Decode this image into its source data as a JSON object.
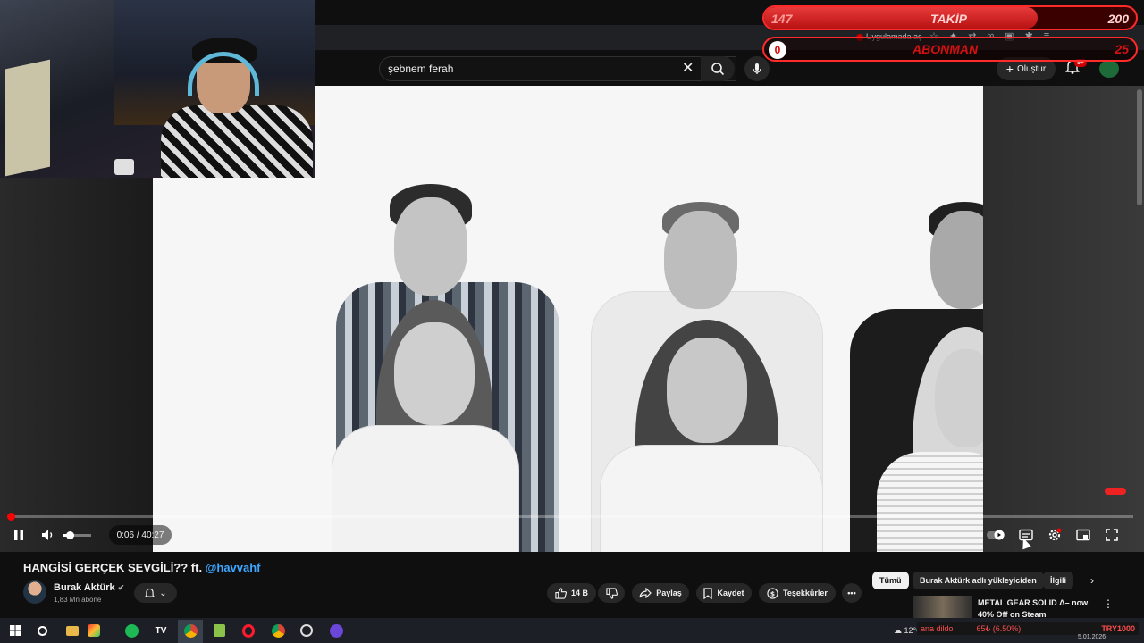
{
  "browser": {
    "app_open_label": "Uygulamada aç"
  },
  "overlay": {
    "follow": {
      "current": "147",
      "label": "TAKİP",
      "goal": "200",
      "progress": 0.735
    },
    "subscribe": {
      "current": "0",
      "label": "ABONMAN",
      "goal": "25",
      "progress": 0.0
    }
  },
  "masthead": {
    "search_value": "şebnem ferah",
    "create_label": "Oluştur",
    "notifications_badge": "9+"
  },
  "player": {
    "time": "0:06 / 40:27",
    "progress": 0.0025,
    "volume": 0.3
  },
  "video": {
    "title_main": "HANGİSİ GERÇEK SEVGİLİ?? ft.",
    "title_mention": "@havvahf",
    "channel_name": "Burak Aktürk",
    "channel_subs": "1,83 Mn abone",
    "likes": "14 B",
    "share_label": "Paylaş",
    "save_label": "Kaydet",
    "thanks_label": "Teşekkürler"
  },
  "chips": [
    {
      "label": "Tümü"
    },
    {
      "label": "Burak Aktürk adlı yükleyiciden"
    },
    {
      "label": "İlgili"
    }
  ],
  "recommendation": {
    "title": "METAL GEAR SOLID Δ– now 40% Off on Steam"
  },
  "taskbar": {
    "weather": "12°C",
    "ticker_left": "ana dildo",
    "ticker_mid": "65₺ (6.50%)",
    "ticker_right": "TRY1000",
    "date": "5.01.2026"
  },
  "colors": {
    "yt_red": "#ff0000",
    "overlay_red": "#ff2a2a",
    "link_blue": "#3ea6ff"
  }
}
